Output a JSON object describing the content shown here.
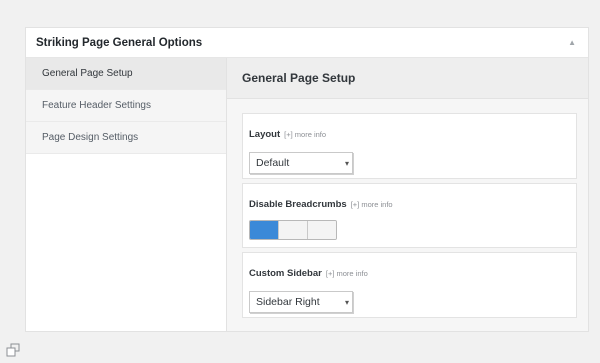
{
  "metabox": {
    "title": "Striking Page General Options",
    "toggle_icon": "chevron-up-icon"
  },
  "tabs": [
    {
      "label": "General Page Setup",
      "active": true
    },
    {
      "label": "Feature Header Settings",
      "active": false
    },
    {
      "label": "Page Design Settings",
      "active": false
    }
  ],
  "panel": {
    "title": "General Page Setup",
    "options": [
      {
        "label": "Layout",
        "more_info": "[+] more info",
        "control": "select",
        "value": "Default"
      },
      {
        "label": "Disable Breadcrumbs",
        "more_info": "[+] more info",
        "control": "toggle",
        "state": "off"
      },
      {
        "label": "Custom Sidebar",
        "more_info": "[+] more info",
        "control": "select",
        "value": "Sidebar Right"
      }
    ]
  },
  "colors": {
    "accent": "#3b89d8",
    "background": "#f1f1f1"
  }
}
